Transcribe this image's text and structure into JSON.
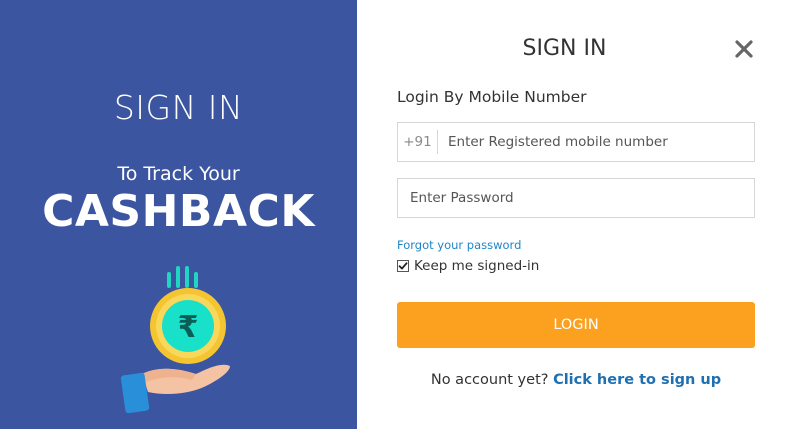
{
  "left_panel": {
    "title": "SIGN IN",
    "subtitle": "To Track Your",
    "headline": "CASHBACK",
    "illustration_icon": "rupee-coin-in-hand",
    "coin_symbol": "₹",
    "colors": {
      "background": "#3b55a0",
      "coin_outer": "#f4c431",
      "coin_inner": "#19e0c8",
      "accent_lines": "#1fd6c3",
      "sleeve": "#2a8fd9",
      "hand": "#f4c3a3"
    }
  },
  "modal": {
    "title": "SIGN IN",
    "close_icon": "close-x",
    "section_label": "Login By Mobile Number",
    "phone": {
      "prefix": "+91",
      "placeholder": "Enter Registered mobile number",
      "value": ""
    },
    "password": {
      "placeholder": "Enter Password",
      "value": ""
    },
    "forgot_password": "Forgot your password",
    "keep_signed_in": {
      "label": "Keep me signed-in",
      "checked": true
    },
    "login_button": "LOGIN",
    "signup": {
      "prompt": "No account yet?",
      "link": "Click here to sign up"
    },
    "colors": {
      "login_button": "#fba01f",
      "link": "#1e86c8",
      "signup_link": "#1f6fb1"
    }
  }
}
